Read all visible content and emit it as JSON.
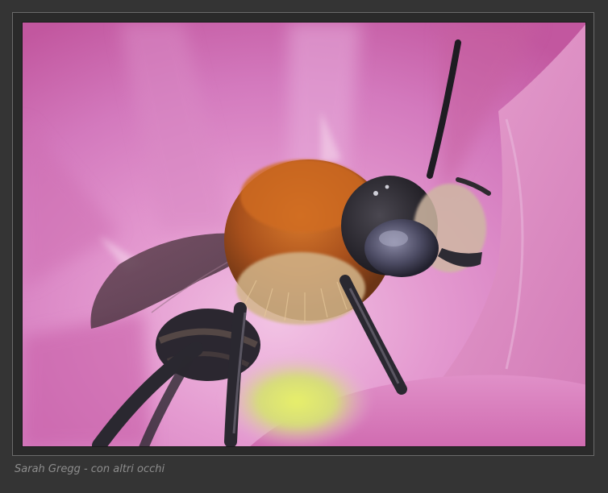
{
  "caption": "Sarah Gregg - con altri occhi",
  "colors": {
    "page_background": "#343434",
    "frame_border": "#6a6a6a",
    "petal_light": "#e8a6d4",
    "petal_mid": "#d272b6",
    "petal_dark": "#a8427e",
    "bee_fur": "#b9561e",
    "bee_body": "#2b2730",
    "caption_text": "#8d8d8d"
  },
  "photo": {
    "subject": "macro-bee-on-pink-flower"
  }
}
